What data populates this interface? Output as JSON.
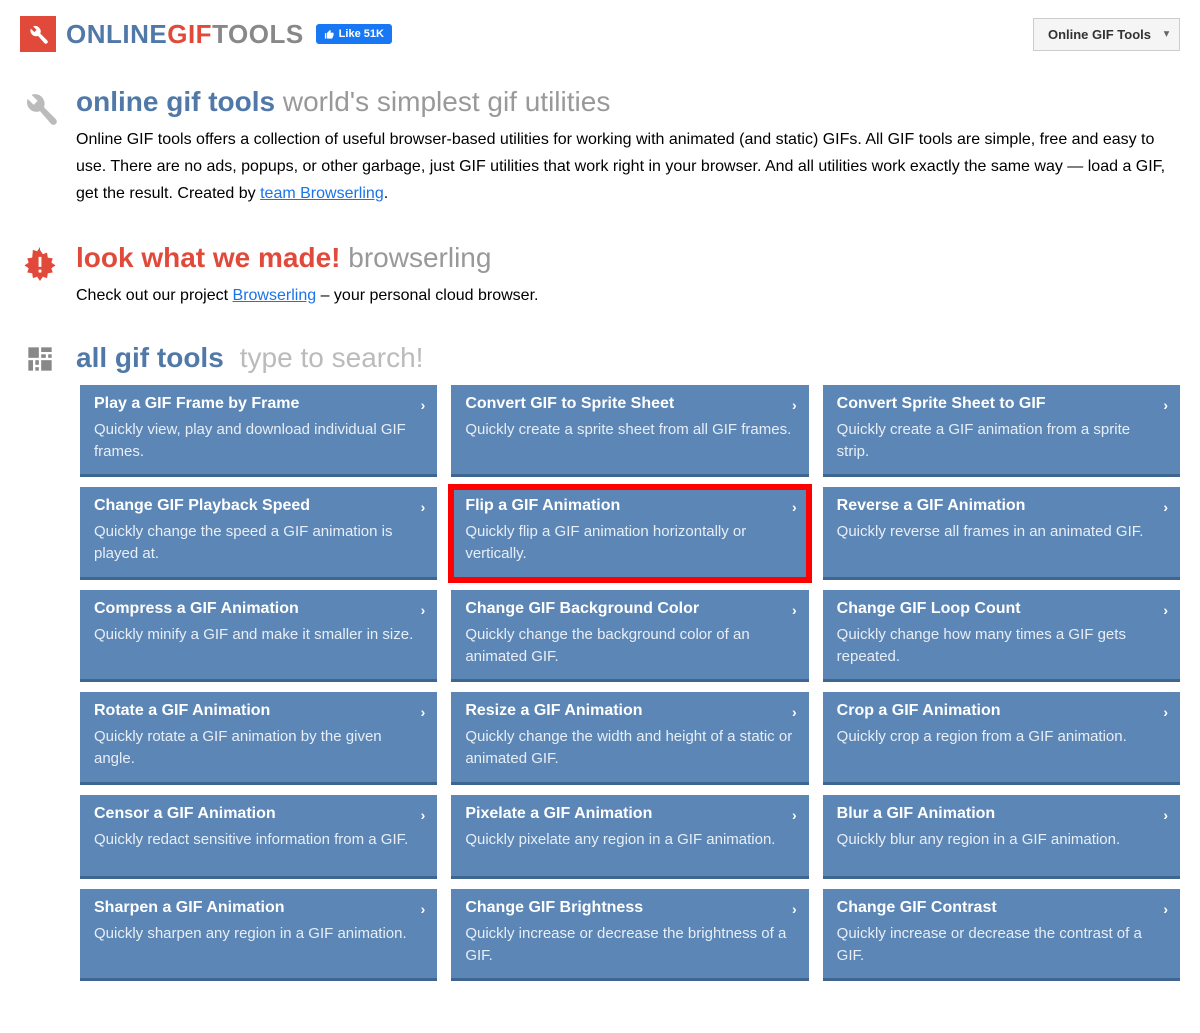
{
  "header": {
    "logo": {
      "online": "ONLINE",
      "gif": "GIF",
      "tools": "TOOLS"
    },
    "fb_like": "Like 51K",
    "dropdown": "Online GIF Tools"
  },
  "intro": {
    "heading_accent": "online gif tools",
    "heading_muted": "world's simplest gif utilities",
    "desc_1": "Online GIF tools offers a collection of useful browser-based utilities for working with animated (and static) GIFs. All GIF tools are simple, free and easy to use. There are no ads, popups, or other garbage, just GIF utilities that work right in your browser. And all utilities work exactly the same way — load a GIF, get the result. Created by ",
    "desc_link": "team Browserling",
    "desc_end": "."
  },
  "made": {
    "heading_accent": "look what we made!",
    "heading_muted": "browserling",
    "desc_1": "Check out our project ",
    "desc_link": "Browserling",
    "desc_end": " – your personal cloud browser."
  },
  "alltools": {
    "label": "all gif tools",
    "placeholder": "type to search!"
  },
  "cards": [
    {
      "title": "Play a GIF Frame by Frame",
      "desc": "Quickly view, play and download individual GIF frames.",
      "hl": false
    },
    {
      "title": "Convert GIF to Sprite Sheet",
      "desc": "Quickly create a sprite sheet from all GIF frames.",
      "hl": false
    },
    {
      "title": "Convert Sprite Sheet to GIF",
      "desc": "Quickly create a GIF animation from a sprite strip.",
      "hl": false
    },
    {
      "title": "Change GIF Playback Speed",
      "desc": "Quickly change the speed a GIF animation is played at.",
      "hl": false
    },
    {
      "title": "Flip a GIF Animation",
      "desc": "Quickly flip a GIF animation horizontally or vertically.",
      "hl": true
    },
    {
      "title": "Reverse a GIF Animation",
      "desc": "Quickly reverse all frames in an animated GIF.",
      "hl": false
    },
    {
      "title": "Compress a GIF Animation",
      "desc": "Quickly minify a GIF and make it smaller in size.",
      "hl": false
    },
    {
      "title": "Change GIF Background Color",
      "desc": "Quickly change the background color of an animated GIF.",
      "hl": false
    },
    {
      "title": "Change GIF Loop Count",
      "desc": "Quickly change how many times a GIF gets repeated.",
      "hl": false
    },
    {
      "title": "Rotate a GIF Animation",
      "desc": "Quickly rotate a GIF animation by the given angle.",
      "hl": false
    },
    {
      "title": "Resize a GIF Animation",
      "desc": "Quickly change the width and height of a static or animated GIF.",
      "hl": false
    },
    {
      "title": "Crop a GIF Animation",
      "desc": "Quickly crop a region from a GIF animation.",
      "hl": false
    },
    {
      "title": "Censor a GIF Animation",
      "desc": "Quickly redact sensitive information from a GIF.",
      "hl": false
    },
    {
      "title": "Pixelate a GIF Animation",
      "desc": "Quickly pixelate any region in a GIF animation.",
      "hl": false
    },
    {
      "title": "Blur a GIF Animation",
      "desc": "Quickly blur any region in a GIF animation.",
      "hl": false
    },
    {
      "title": "Sharpen a GIF Animation",
      "desc": "Quickly sharpen any region in a GIF animation.",
      "hl": false
    },
    {
      "title": "Change GIF Brightness",
      "desc": "Quickly increase or decrease the brightness of a GIF.",
      "hl": false
    },
    {
      "title": "Change GIF Contrast",
      "desc": "Quickly increase or decrease the contrast of a GIF.",
      "hl": false
    }
  ]
}
